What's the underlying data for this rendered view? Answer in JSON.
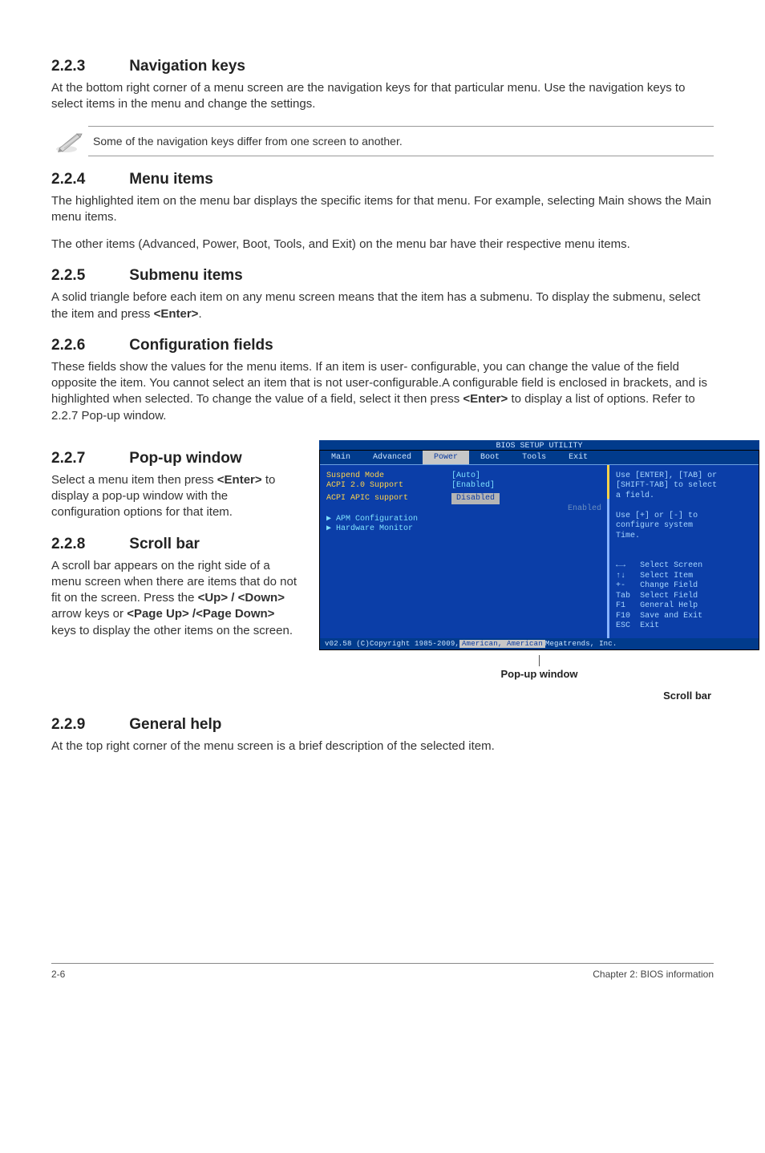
{
  "sections": {
    "s223": {
      "num": "2.2.3",
      "title": "Navigation keys",
      "p1": "At the bottom right corner of a menu screen are the navigation keys for that particular menu. Use the navigation keys to select items in the menu and change the settings."
    },
    "note": "Some of the navigation keys differ from one screen to another.",
    "s224": {
      "num": "2.2.4",
      "title": "Menu items",
      "p1": "The highlighted item on the menu bar displays the specific items for that menu. For example, selecting Main shows the Main menu items.",
      "p2": "The other items (Advanced, Power, Boot, Tools, and Exit) on the menu bar have their respective menu items."
    },
    "s225": {
      "num": "2.2.5",
      "title": "Submenu items",
      "p1_a": "A solid triangle before each item on any menu screen means that the item has a submenu. To display the submenu, select the item and press ",
      "p1_b": "<Enter>",
      "p1_c": "."
    },
    "s226": {
      "num": "2.2.6",
      "title": "Configuration fields",
      "p1_a": "These fields show the values for the menu items. If an item is user- configurable, you can change the value of the field opposite the item. You cannot select an item that is not user-configurable.A configurable field is enclosed in brackets, and is highlighted when selected. To change the value of a field, select it then press ",
      "p1_b": "<Enter>",
      "p1_c": " to display a list of options. Refer to 2.2.7 Pop-up window."
    },
    "s227": {
      "num": "2.2.7",
      "title": "Pop-up window",
      "p1_a": "Select a menu item then press ",
      "p1_b": "<Enter>",
      "p1_c": " to display a pop-up window with the configuration options for that item."
    },
    "s228": {
      "num": "2.2.8",
      "title": "Scroll bar",
      "p1_a": "A scroll bar appears on the right side of a menu screen when there are items that do not fit on the screen. Press the ",
      "p1_b": "<Up> / <Down>",
      "p1_c": " arrow keys or ",
      "p1_d": "<Page Up> /<Page Down>",
      "p1_e": " keys to display the other items on the screen."
    },
    "s229": {
      "num": "2.2.9",
      "title": "General help",
      "p1": "At the top right corner of the menu screen is a brief description of the selected item."
    }
  },
  "bios": {
    "utility_title": "BIOS SETUP UTILITY",
    "tabs": [
      "Main",
      "Advanced",
      "Power",
      "Boot",
      "Tools",
      "Exit"
    ],
    "active_tab": "Power",
    "left": {
      "r1": "Suspend Mode",
      "v1": "[Auto]",
      "r2": "ACPI 2.0 Support",
      "v2": "[Enabled]",
      "r3": "ACPI APIC support",
      "v3_sel": "Disabled",
      "v3_dim": "Enabled",
      "sub1": "▶ APM Configuration",
      "sub2": "▶ Hardware Monitor"
    },
    "right": {
      "h1": "Use [ENTER], [TAB] or",
      "h2": "[SHIFT-TAB] to select",
      "h3": "a field.",
      "h4": "Use [+] or [-] to",
      "h5": "configure system",
      "h6": "Time.",
      "k_arrows": "←→",
      "k_arrows_t": "Select Screen",
      "k_ud": "↑↓",
      "k_ud_t": "Select Item",
      "k_pm": "+-",
      "k_pm_t": "Change Field",
      "k_tab": "Tab",
      "k_tab_t": "Select Field",
      "k_f1": "F1",
      "k_f1_t": "General Help",
      "k_f10": "F10",
      "k_f10_t": "Save and Exit",
      "k_esc": "ESC",
      "k_esc_t": "Exit"
    },
    "footer_a": "v02.58 (C)Copyright 1985-2009, ",
    "footer_b": "American, American",
    "footer_c": " Megatrends, Inc."
  },
  "callouts": {
    "popup": "Pop-up window",
    "scroll": "Scroll bar"
  },
  "pagefoot": {
    "left": "2-6",
    "right": "Chapter 2: BIOS information"
  }
}
